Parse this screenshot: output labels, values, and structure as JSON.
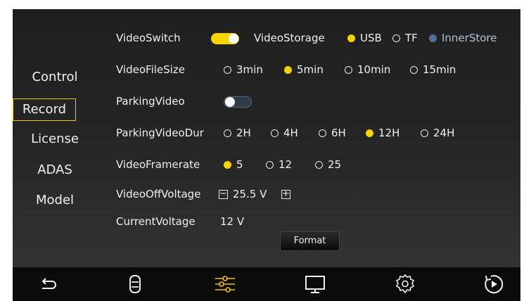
{
  "sidebar": {
    "items": [
      {
        "label": "Control",
        "active": false
      },
      {
        "label": "Record",
        "active": true
      },
      {
        "label": "License",
        "active": false
      },
      {
        "label": "ADAS",
        "active": false
      },
      {
        "label": "Model",
        "active": false
      }
    ]
  },
  "settings": {
    "video_switch": {
      "label": "VideoSwitch",
      "on": true
    },
    "video_storage": {
      "label": "VideoStorage",
      "options": [
        {
          "label": "USB",
          "state": "selected"
        },
        {
          "label": "TF",
          "state": "unselected"
        },
        {
          "label": "InnerStore",
          "state": "disabled"
        }
      ]
    },
    "video_file_size": {
      "label": "VideoFileSize",
      "options": [
        {
          "label": "3min",
          "state": "unselected"
        },
        {
          "label": "5min",
          "state": "selected"
        },
        {
          "label": "10min",
          "state": "unselected"
        },
        {
          "label": "15min",
          "state": "unselected"
        }
      ]
    },
    "parking_video": {
      "label": "ParkingVideo",
      "on": false
    },
    "parking_video_dur": {
      "label": "ParkingVideoDur",
      "options": [
        {
          "label": "2H",
          "state": "unselected"
        },
        {
          "label": "4H",
          "state": "unselected"
        },
        {
          "label": "6H",
          "state": "unselected"
        },
        {
          "label": "12H",
          "state": "selected"
        },
        {
          "label": "24H",
          "state": "unselected"
        }
      ]
    },
    "video_framerate": {
      "label": "VideoFramerate",
      "options": [
        {
          "label": "5",
          "state": "selected"
        },
        {
          "label": "12",
          "state": "unselected"
        },
        {
          "label": "25",
          "state": "unselected"
        }
      ]
    },
    "video_off_voltage": {
      "label": "VideoOffVoltage",
      "value": "25.5 V",
      "minus": "−",
      "plus": "+"
    },
    "current_voltage": {
      "label": "CurrentVoltage",
      "value": "12 V"
    },
    "format_button": "Format"
  },
  "bottom_nav": {
    "items": [
      {
        "icon": "back-icon"
      },
      {
        "icon": "car-icon"
      },
      {
        "icon": "sliders-icon",
        "active": true
      },
      {
        "icon": "monitor-icon"
      },
      {
        "icon": "gear-icon"
      },
      {
        "icon": "play-icon"
      }
    ]
  },
  "colors": {
    "accent": "#f5d400",
    "toggle_on": "#f5d400",
    "toggle_off": "#2e3a4a",
    "disabled_radio": "#4e6d8f",
    "panel_bg": "#232323",
    "nav_bg": "#0b0b0b"
  }
}
